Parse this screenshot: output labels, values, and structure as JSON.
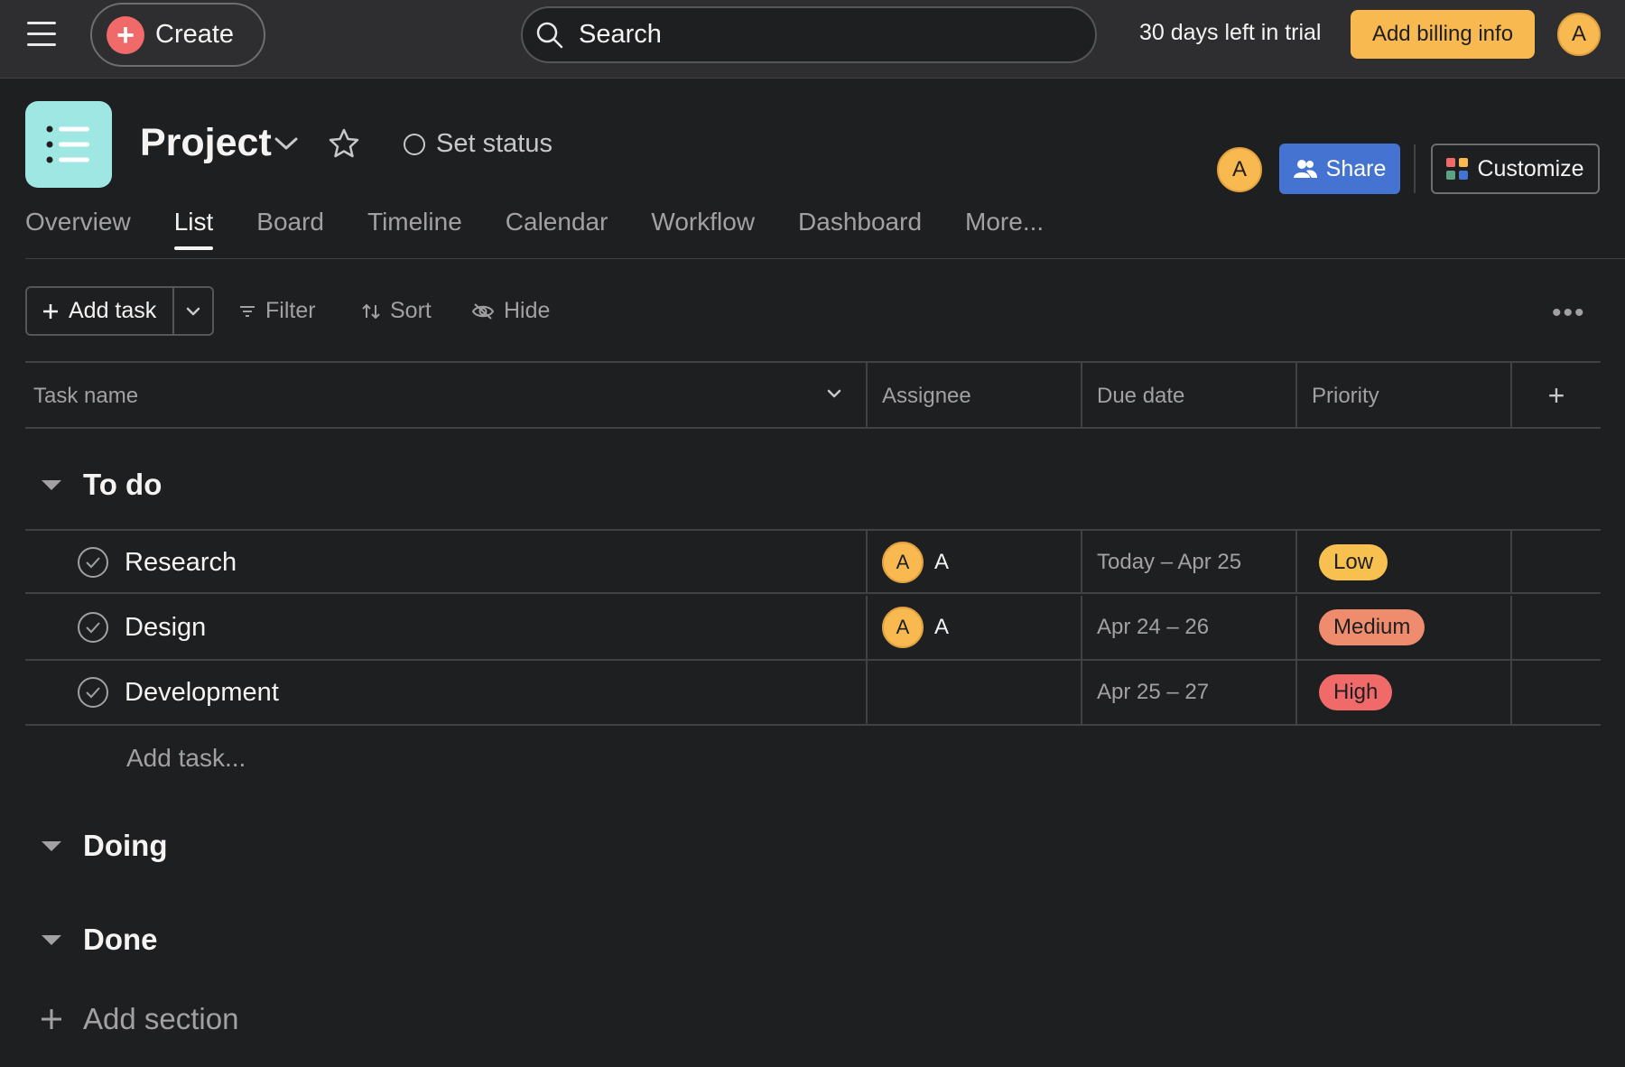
{
  "topbar": {
    "create_label": "Create",
    "search_placeholder": "Search",
    "trial_text": "30 days left in trial",
    "billing_label": "Add billing info",
    "user_initial": "A"
  },
  "project": {
    "title": "Project",
    "set_status_label": "Set status",
    "member_initial": "A",
    "share_label": "Share",
    "customize_label": "Customize"
  },
  "tabs": [
    "Overview",
    "List",
    "Board",
    "Timeline",
    "Calendar",
    "Workflow",
    "Dashboard",
    "More..."
  ],
  "active_tab": "List",
  "toolbar": {
    "add_task_label": "Add task",
    "filter_label": "Filter",
    "sort_label": "Sort",
    "hide_label": "Hide",
    "more_label": "•••"
  },
  "columns": {
    "task_name": "Task name",
    "assignee": "Assignee",
    "due_date": "Due date",
    "priority": "Priority",
    "add_column": "+"
  },
  "sections": [
    {
      "name": "To do",
      "tasks": [
        {
          "name": "Research",
          "assignee_initial": "A",
          "assignee_name": "A",
          "due": "Today – Apr 25",
          "priority": "Low"
        },
        {
          "name": "Design",
          "assignee_initial": "A",
          "assignee_name": "A",
          "due": "Apr 24 – 26",
          "priority": "Medium"
        },
        {
          "name": "Development",
          "assignee_initial": "",
          "assignee_name": "",
          "due": "Apr 25 – 27",
          "priority": "High"
        }
      ],
      "add_task_placeholder": "Add task..."
    },
    {
      "name": "Doing",
      "tasks": []
    },
    {
      "name": "Done",
      "tasks": []
    }
  ],
  "add_section_label": "Add section",
  "colors": {
    "background": "#1e1f21",
    "topbar": "#2e2e30",
    "accent_billing": "#f8b951",
    "share_blue": "#4573d2",
    "create_red": "#f06a6a",
    "project_icon": "#9ee7e3",
    "priority_low": "#f8c04e",
    "priority_medium": "#ef8c6e",
    "priority_high": "#f06a6a"
  }
}
